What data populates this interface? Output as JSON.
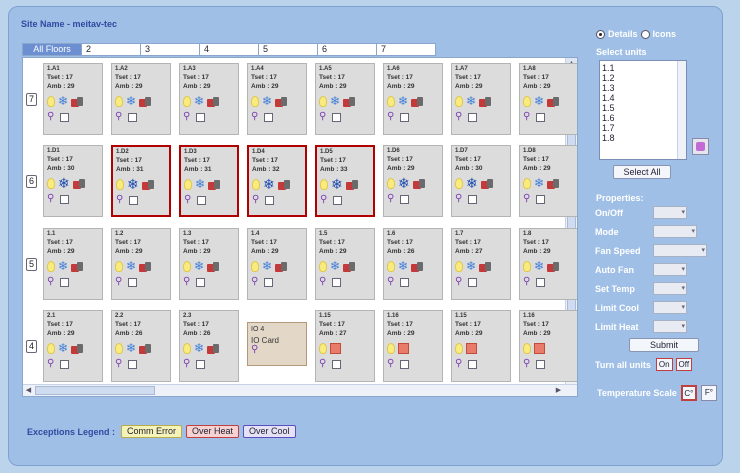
{
  "site_name": "Site Name - meitav-tec",
  "tabs": [
    "All Floors",
    "2",
    "3",
    "4",
    "5",
    "6",
    "7"
  ],
  "floors": [
    {
      "label": "7",
      "units": [
        {
          "name": "1.A1",
          "tset": "Tset : 17",
          "amb": "Amb : 29",
          "mode": "cool",
          "exc": false
        },
        {
          "name": "1.A2",
          "tset": "Tset : 17",
          "amb": "Amb : 29",
          "mode": "cool",
          "exc": false
        },
        {
          "name": "1.A3",
          "tset": "Tset : 17",
          "amb": "Amb : 29",
          "mode": "cool",
          "exc": false
        },
        {
          "name": "1.A4",
          "tset": "Tset : 17",
          "amb": "Amb : 29",
          "mode": "cool",
          "exc": false
        },
        {
          "name": "1.A5",
          "tset": "Tset : 17",
          "amb": "Amb : 29",
          "mode": "cool",
          "exc": false
        },
        {
          "name": "1.A6",
          "tset": "Tset : 17",
          "amb": "Amb : 29",
          "mode": "cool",
          "exc": false
        },
        {
          "name": "1.A7",
          "tset": "Tset : 17",
          "amb": "Amb : 29",
          "mode": "cool",
          "exc": false
        },
        {
          "name": "1.A8",
          "tset": "Tset : 17",
          "amb": "Amb : 29",
          "mode": "cool",
          "exc": false
        }
      ]
    },
    {
      "label": "6",
      "units": [
        {
          "name": "1.D1",
          "tset": "Tset : 17",
          "amb": "Amb : 30",
          "mode": "cool-strong",
          "exc": false
        },
        {
          "name": "1.D2",
          "tset": "Tset : 17",
          "amb": "Amb : 31",
          "mode": "cool-strong",
          "exc": true
        },
        {
          "name": "1.D3",
          "tset": "Tset : 17",
          "amb": "Amb : 31",
          "mode": "cool",
          "exc": true
        },
        {
          "name": "1.D4",
          "tset": "Tset : 17",
          "amb": "Amb : 32",
          "mode": "cool-strong",
          "exc": true
        },
        {
          "name": "1.D5",
          "tset": "Tset : 17",
          "amb": "Amb : 33",
          "mode": "cool-strong",
          "exc": true
        },
        {
          "name": "1.D6",
          "tset": "Tset : 17",
          "amb": "Amb : 29",
          "mode": "cool-strong",
          "exc": false
        },
        {
          "name": "1.D7",
          "tset": "Tset : 17",
          "amb": "Amb : 30",
          "mode": "cool-strong",
          "exc": false
        },
        {
          "name": "1.D8",
          "tset": "Tset : 17",
          "amb": "Amb : 29",
          "mode": "cool",
          "exc": false
        }
      ]
    },
    {
      "label": "5",
      "units": [
        {
          "name": "1.1",
          "tset": "Tset : 17",
          "amb": "Amb : 29",
          "mode": "cool",
          "exc": false
        },
        {
          "name": "1.2",
          "tset": "Tset : 17",
          "amb": "Amb : 29",
          "mode": "cool",
          "exc": false
        },
        {
          "name": "1.3",
          "tset": "Tset : 17",
          "amb": "Amb : 29",
          "mode": "cool",
          "exc": false
        },
        {
          "name": "1.4",
          "tset": "Tset : 17",
          "amb": "Amb : 29",
          "mode": "cool",
          "exc": false
        },
        {
          "name": "1.5",
          "tset": "Tset : 17",
          "amb": "Amb : 29",
          "mode": "cool",
          "exc": false
        },
        {
          "name": "1.6",
          "tset": "Tset : 17",
          "amb": "Amb : 26",
          "mode": "cool",
          "exc": false
        },
        {
          "name": "1.7",
          "tset": "Tset : 17",
          "amb": "Amb : 27",
          "mode": "cool",
          "exc": false
        },
        {
          "name": "1.8",
          "tset": "Tset : 17",
          "amb": "Amb : 29",
          "mode": "cool",
          "exc": false
        }
      ]
    },
    {
      "label": "4",
      "units": [
        {
          "name": "2.1",
          "tset": "Tset : 17",
          "amb": "Amb : 29",
          "mode": "cool",
          "exc": false
        },
        {
          "name": "2.2",
          "tset": "Tset : 17",
          "amb": "Amb : 26",
          "mode": "cool",
          "exc": false
        },
        {
          "name": "2.3",
          "tset": "Tset : 17",
          "amb": "Amb : 26",
          "mode": "cool",
          "exc": false
        },
        {
          "name": "IO",
          "io_name": "IO 4",
          "io_label": "IO Card"
        },
        {
          "name": "1.15",
          "tset": "Tset : 17",
          "amb": "Amb : 27",
          "mode": "heat",
          "exc": false
        },
        {
          "name": "1.16",
          "tset": "Tset : 17",
          "amb": "Amb : 29",
          "mode": "heat",
          "exc": false
        },
        {
          "name": "1.15",
          "tset": "Tset : 17",
          "amb": "Amb : 29",
          "mode": "heat",
          "exc": false
        },
        {
          "name": "1.16",
          "tset": "Tset : 17",
          "amb": "Amb : 29",
          "mode": "heat",
          "exc": false
        }
      ]
    }
  ],
  "legend": {
    "label": "Exceptions Legend :",
    "items": [
      "Comm Error",
      "Over Heat",
      "Over Cool"
    ]
  },
  "view": {
    "details": "Details",
    "icons": "Icons",
    "selected": "details"
  },
  "select_units": {
    "label": "Select units",
    "items": [
      "1.1",
      "1.2",
      "1.3",
      "1.4",
      "1.5",
      "1.6",
      "1.7",
      "1.8"
    ],
    "select_all": "Select All"
  },
  "properties": {
    "label": "Properties:",
    "fields": [
      {
        "label": "On/Off",
        "size": "sm"
      },
      {
        "label": "Mode",
        "size": "md"
      },
      {
        "label": "Fan Speed",
        "size": "lgs"
      },
      {
        "label": "Auto Fan",
        "size": "sm"
      },
      {
        "label": "Set Temp",
        "size": "sm"
      },
      {
        "label": "Limit Cool",
        "size": "sm"
      },
      {
        "label": "Limit Heat",
        "size": "sm"
      }
    ],
    "submit": "Submit"
  },
  "turn_all": {
    "label": "Turn all units",
    "on": "On",
    "off": "Off"
  },
  "temp_scale": {
    "label": "Temperature Scale",
    "c": "C°",
    "f": "F°",
    "selected": "c"
  }
}
